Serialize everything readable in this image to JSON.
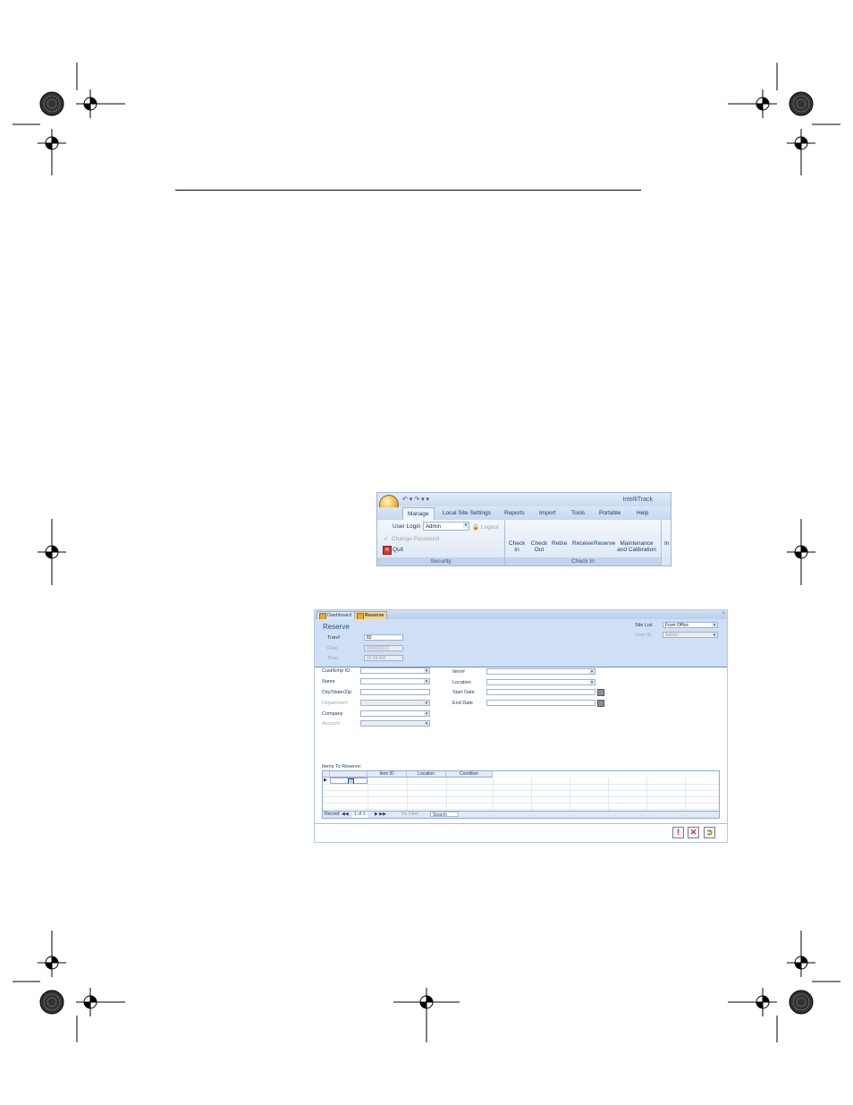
{
  "ribbon": {
    "app_title": "IntelliTrack",
    "tabs": [
      "Manage",
      "Local Site Settings",
      "Reports",
      "Import",
      "Tools",
      "Portable",
      "Help"
    ],
    "security": {
      "user_login_label": "User Login",
      "user_value": "Admin",
      "logout_label": "Logout",
      "change_password_label": "Change Password",
      "quit_label": "Quit",
      "group_label": "Security"
    },
    "checkin": {
      "buttons": [
        "Check In",
        "Check Out",
        "Retire",
        "Receive",
        "Reserve",
        "Maintenance and Calibration"
      ],
      "group_label": "Check In",
      "overflow_label": "In"
    }
  },
  "form": {
    "tabs": [
      "Dashboard",
      "Reserve"
    ],
    "title": "Reserve",
    "tran_label": "Tran#",
    "tran_value": "83",
    "date_label": "Date",
    "date_value": "04/05/2010",
    "time_label": "Time",
    "time_value": "10:18 AM",
    "site_list_label": "Site List",
    "site_list_value": "Front Office",
    "user_id_label": "User ID",
    "user_id_value": "Admin",
    "left_labels": [
      "Cust/Emp ID",
      "Name",
      "City/State/Zip",
      "Department",
      "Company",
      "Account"
    ],
    "right_labels": [
      "Item#",
      "Location",
      "Start Date",
      "End Date"
    ],
    "grid_title": "Items To Reserve:",
    "grid_headers": [
      "",
      "Item ID",
      "Location",
      "Condition"
    ],
    "nav": {
      "record_label": "Record:",
      "position": "1 of 1",
      "filter_label": "No Filter",
      "search_label": "Search"
    }
  }
}
